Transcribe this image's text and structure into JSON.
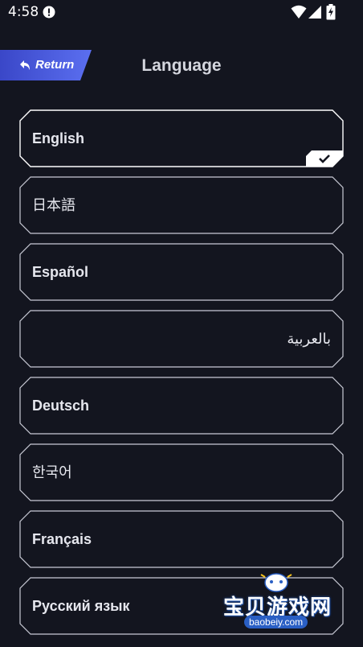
{
  "status_bar": {
    "time": "4:58"
  },
  "header": {
    "return_label": "Return",
    "title": "Language"
  },
  "languages": [
    {
      "label": "English",
      "selected": true
    },
    {
      "label": "日本語",
      "selected": false
    },
    {
      "label": "Español",
      "selected": false
    },
    {
      "label": "بالعربية",
      "selected": false
    },
    {
      "label": "Deutsch",
      "selected": false
    },
    {
      "label": "한국어",
      "selected": false
    },
    {
      "label": "Français",
      "selected": false
    },
    {
      "label": "Русский язык",
      "selected": false
    }
  ],
  "watermark": {
    "title": "宝贝游戏网",
    "url": "baobeiy.com"
  },
  "colors": {
    "background": "#13151f",
    "accent": "#4a5ee8",
    "frame": "#c9cbd6"
  }
}
